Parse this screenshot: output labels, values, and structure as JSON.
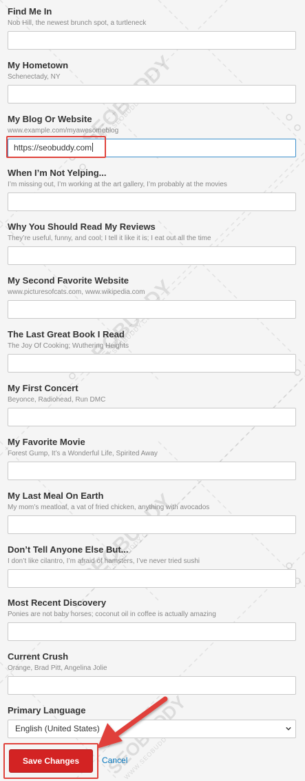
{
  "fields": [
    {
      "label": "Find Me In",
      "hint": "Nob Hill, the newest brunch spot, a turtleneck",
      "value": ""
    },
    {
      "label": "My Hometown",
      "hint": "Schenectady, NY",
      "value": ""
    },
    {
      "label": "My Blog Or Website",
      "hint": "www.example.com/myawesomeblog",
      "value": "https://seobuddy.com"
    },
    {
      "label": "When I’m Not Yelping...",
      "hint": "I’m missing out, I’m working at the art gallery, I’m probably at the movies",
      "value": ""
    },
    {
      "label": "Why You Should Read My Reviews",
      "hint": "They’re useful, funny, and cool; I tell it like it is; I eat out all the time",
      "value": ""
    },
    {
      "label": "My Second Favorite Website",
      "hint": "www.picturesofcats.com, www.wikipedia.com",
      "value": ""
    },
    {
      "label": "The Last Great Book I Read",
      "hint": "The Joy Of Cooking; Wuthering Heights",
      "value": ""
    },
    {
      "label": "My First Concert",
      "hint": "Beyonce, Radiohead, Run DMC",
      "value": ""
    },
    {
      "label": "My Favorite Movie",
      "hint": "Forest Gump, It’s a Wonderful Life, Spirited Away",
      "value": ""
    },
    {
      "label": "My Last Meal On Earth",
      "hint": "My mom’s meatloaf, a vat of fried chicken, anything with avocados",
      "value": ""
    },
    {
      "label": "Don’t Tell Anyone Else But...",
      "hint": "I don’t like cilantro, I’m afraid of hamsters, I’ve never tried sushi",
      "value": ""
    },
    {
      "label": "Most Recent Discovery",
      "hint": "Ponies are not baby horses; coconut oil in coffee is actually amazing",
      "value": ""
    },
    {
      "label": "Current Crush",
      "hint": "Orange, Brad Pitt, Angelina Jolie",
      "value": ""
    }
  ],
  "language": {
    "label": "Primary Language",
    "selected": "English (United States)"
  },
  "actions": {
    "save_label": "Save Changes",
    "cancel_label": "Cancel"
  },
  "watermark": {
    "brand": "SEOBUDDY",
    "url": "WWW.SEOBUDDY.COM"
  },
  "colors": {
    "accent": "#d32323",
    "highlight": "#e0413a",
    "link": "#0073bb",
    "focus_border": "#3a8fcc"
  },
  "icons": {
    "select": "chevron-down-icon",
    "annotation": "arrow-icon"
  }
}
